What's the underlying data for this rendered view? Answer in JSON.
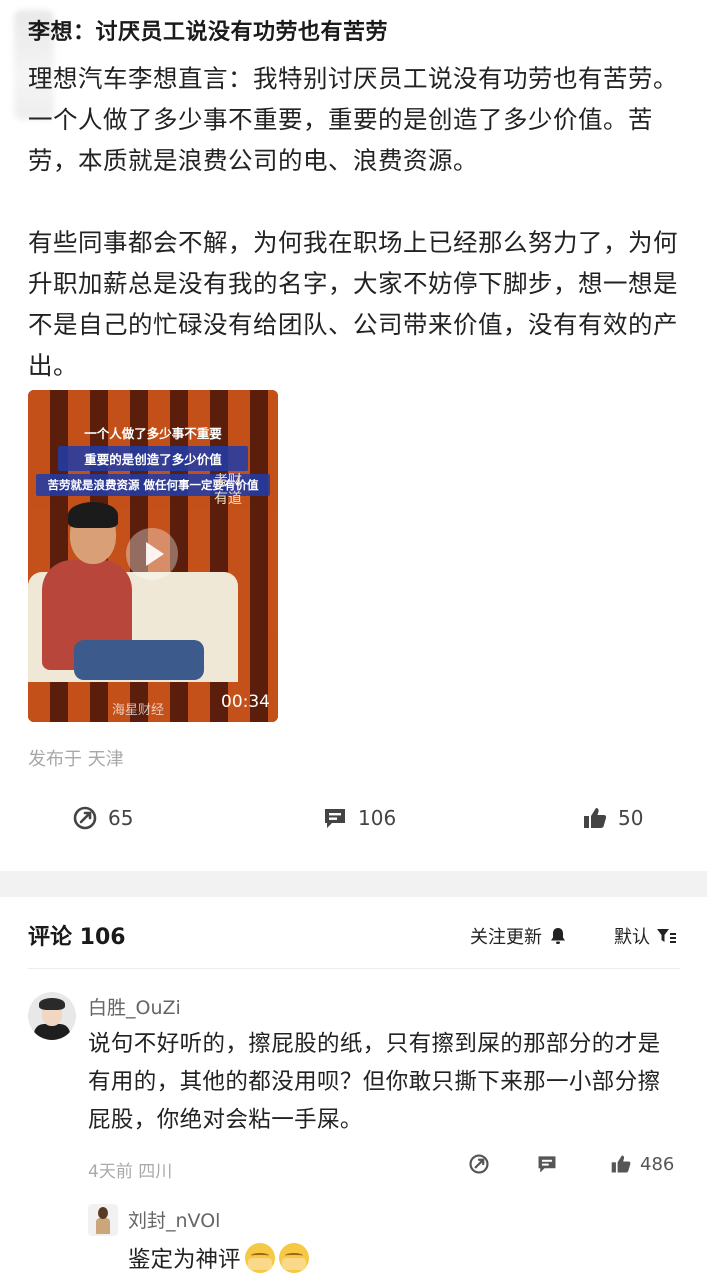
{
  "post": {
    "title": "李想：讨厌员工说没有功劳也有苦劳",
    "paragraphs": [
      "理想汽车李想直言：我特别讨厌员工说没有功劳也有苦劳。一个人做了多少事不重要，重要的是创造了多少价值。苦劳，本质就是浪费公司的电、浪费资源。",
      "有些同事都会不解，为何我在职场上已经那么努力了，为何升职加薪总是没有我的名字，大家不妨停下脚步，想一想是不是自己的忙碌没有给团队、公司带来价值，没有有效的产出。"
    ],
    "video": {
      "caption1": "一个人做了多少事不重要",
      "caption2": "重要的是创造了多少价值",
      "caption3": "苦劳就是浪费资源 做任何事一定要有价值",
      "show_logo": "考财有道",
      "watermark": "海星财经",
      "duration": "00:34"
    },
    "location": "发布于 天津",
    "stats": {
      "shares": "65",
      "comments": "106",
      "likes": "50"
    }
  },
  "comments_section": {
    "title": "评论 106",
    "follow_label": "关注更新",
    "sort_label": "默认"
  },
  "comment": {
    "author": "白胜_OuZi",
    "text": "说句不好听的，擦屁股的纸，只有擦到屎的那部分的才是有用的，其他的都没用呗？但你敢只撕下来那一小部分擦屁股，你绝对会粘一手屎。",
    "meta": "4天前 四川",
    "likes": "486"
  },
  "reply": {
    "author": "刘封_nVOl",
    "text": "鉴定为神评"
  },
  "icons": {
    "share": "share-icon",
    "comment": "comment-icon",
    "like": "thumbs-up-icon",
    "bell": "bell-icon",
    "sort": "sort-filter-icon"
  }
}
